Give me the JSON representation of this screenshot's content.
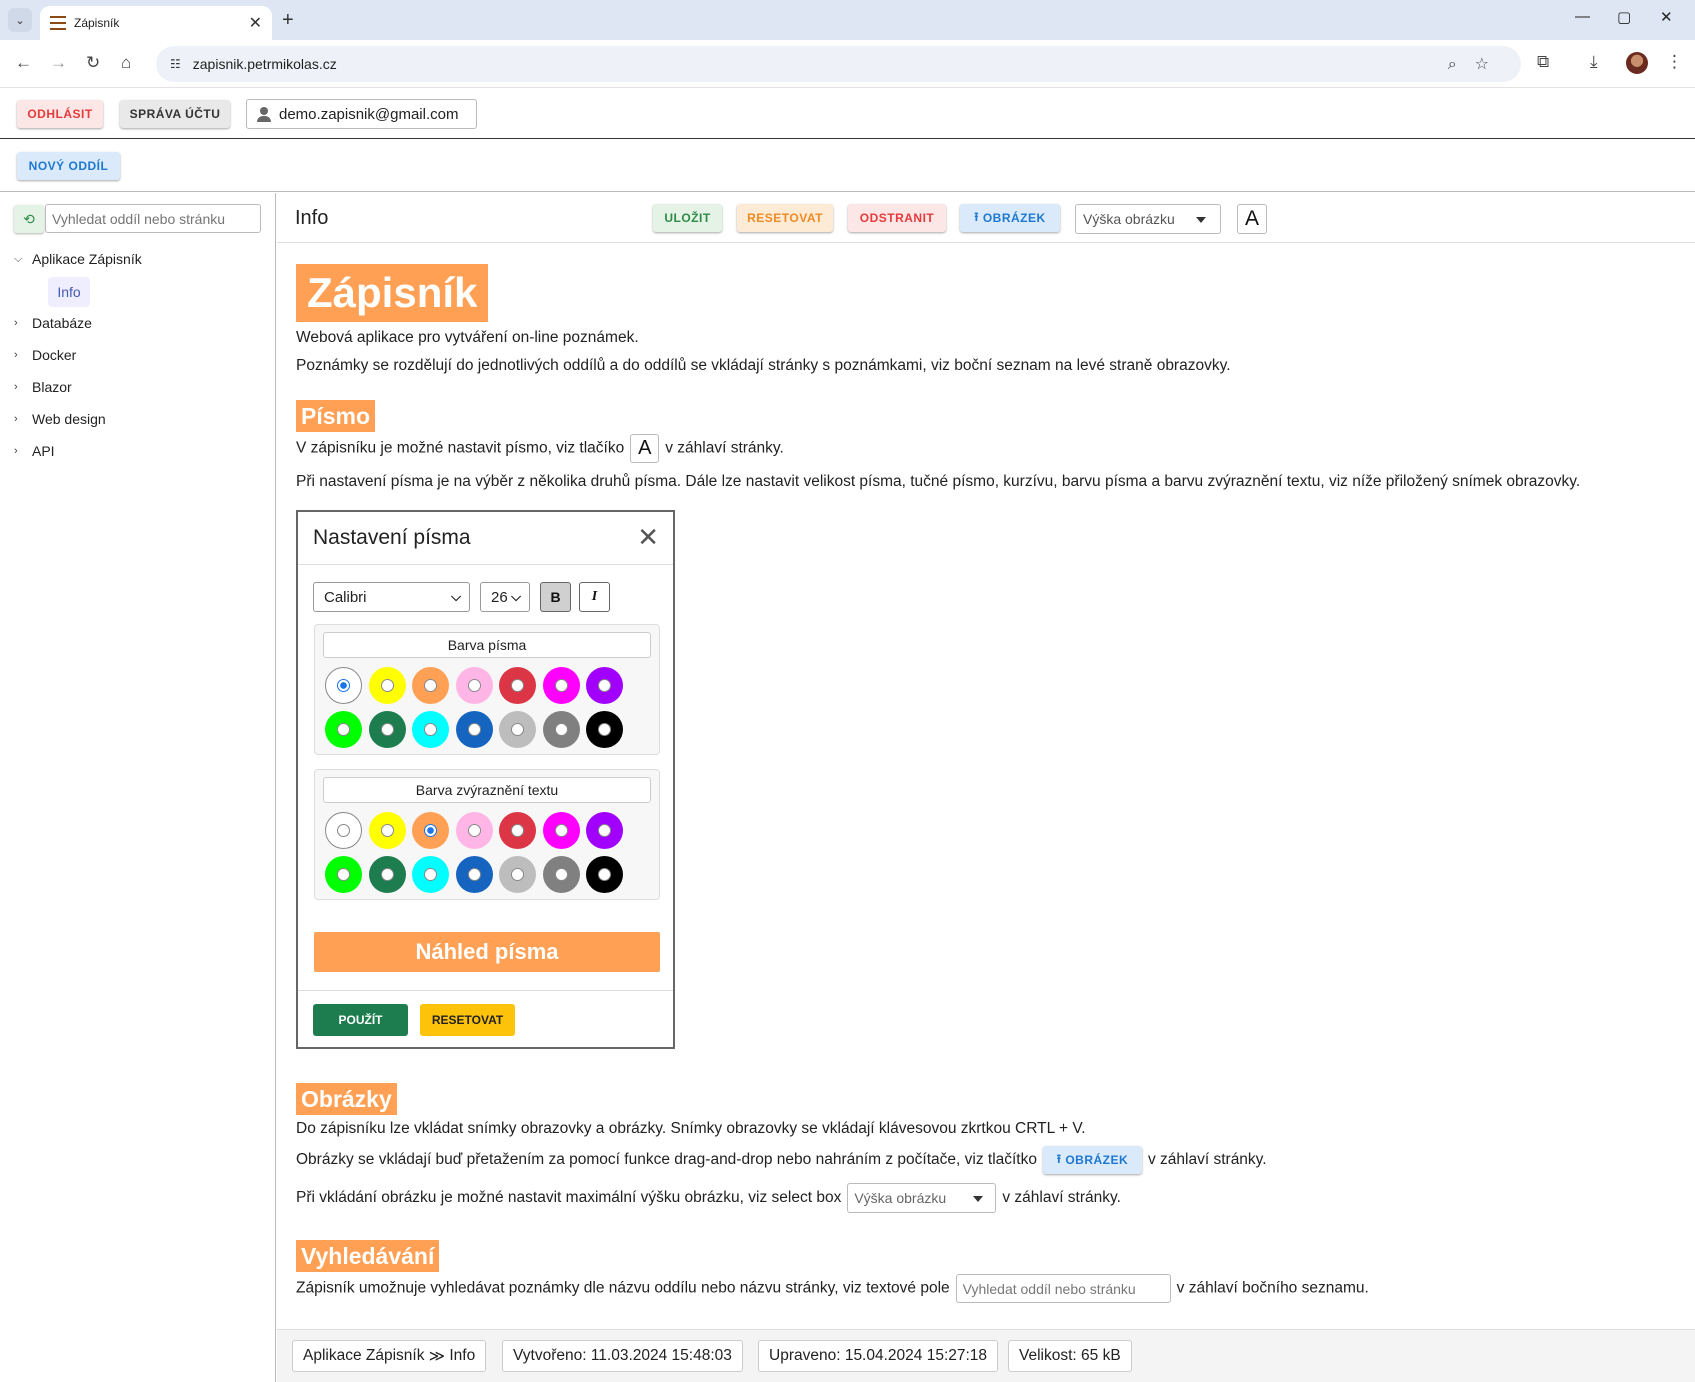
{
  "browser": {
    "tab_title": "Zápisník",
    "url": "zapisnik.petrmikolas.cz"
  },
  "header": {
    "logout_label": "ODHLÁSIT",
    "account_label": "SPRÁVA ÚČTU",
    "user_email": "demo.zapisnik@gmail.com",
    "new_section_label": "NOVÝ ODDÍL"
  },
  "sidebar": {
    "search_placeholder": "Vyhledat oddíl nebo stránku",
    "items": [
      {
        "label": "Aplikace Zápisník",
        "expanded": true,
        "children": [
          {
            "label": "Info",
            "selected": true
          }
        ]
      },
      {
        "label": "Databáze",
        "expanded": false
      },
      {
        "label": "Docker",
        "expanded": false
      },
      {
        "label": "Blazor",
        "expanded": false
      },
      {
        "label": "Web design",
        "expanded": false
      },
      {
        "label": "API",
        "expanded": false
      }
    ]
  },
  "page": {
    "title": "Info",
    "save_label": "ULOŽIT",
    "reset_label": "RESETOVAT",
    "delete_label": "ODSTRANIT",
    "image_label": "OBRÁZEK",
    "image_height_placeholder": "Výška obrázku",
    "font_button_label": "A"
  },
  "content": {
    "h_main": "Zápisník",
    "intro1": "Webová aplikace pro vytváření on-line poznámek.",
    "intro2": "Poznámky se rozdělují do jednotlivých oddílů a do oddílů se vkládají stránky s poznámkami, viz boční seznam na levé straně obrazovky.",
    "h_pismo": "Písmo",
    "pismo1_a": "V zápisníku je možné nastavit písmo, viz tlačíko",
    "pismo1_b": "v záhlaví stránky.",
    "pismo2": "Při nastavení písma je na výběr z několika druhů písma. Dále lze nastavit velikost písma, tučné písmo, kurzívu, barvu písma a barvu zvýraznění textu, viz níže přiložený snímek obrazovky.",
    "h_obrazky": "Obrázky",
    "obr1": "Do zápisníku lze vkládat snímky obrazovky a obrázky. Snímky obrazovky se vkládají klávesovou zkrtkou CRTL + V.",
    "obr2_a": "Obrázky se vkládají buď přetažením za pomocí funkce drag-and-drop nebo nahráním z počítače, viz tlačítko",
    "obr2_b": "v záhlaví stránky.",
    "obr3_a": "Při vkládání obrázku je možné nastavit maximální výšku obrázku, viz select box",
    "obr3_b": "v záhlaví stránky.",
    "h_vyhl": "Vyhledávání",
    "vyhl1_a": "Zápisník umožnuje vyhledávat poznámky dle názvu oddílu nebo názvu stránky, viz textové pole",
    "vyhl1_b": "v záhlaví bočního seznamu."
  },
  "font_dialog": {
    "title": "Nastavení písma",
    "font_family": "Calibri",
    "font_size": "26",
    "bold_label": "B",
    "italic_label": "I",
    "font_color_label": "Barva písma",
    "highlight_color_label": "Barva zvýraznění textu",
    "colors": [
      "#ffffff",
      "#ffff00",
      "#ffa055",
      "#ffb6e6",
      "#dc3545",
      "#ff00ff",
      "#a100ff",
      "#00ff00",
      "#1d7d4e",
      "#00ffff",
      "#1565c0",
      "#bdbdbd",
      "#808080",
      "#000000"
    ],
    "font_color_selected": 0,
    "highlight_color_selected": 2,
    "preview_label": "Náhled písma",
    "apply_label": "POUŽÍT",
    "reset_label": "RESETOVAT"
  },
  "footer": {
    "path_section": "Aplikace Zápisník",
    "path_separator": "≫",
    "path_page": "Info",
    "created": "Vytvořeno: 11.03.2024 15:48:03",
    "modified": "Upraveno: 15.04.2024 15:27:18",
    "size": "Velikost: 65 kB"
  },
  "colors": {
    "heading_bg": "#ffa055",
    "accent_blue": "#1e78d0",
    "accent_green": "#2e8b46",
    "accent_red": "#e43b3b",
    "accent_orange": "#f08a24"
  }
}
